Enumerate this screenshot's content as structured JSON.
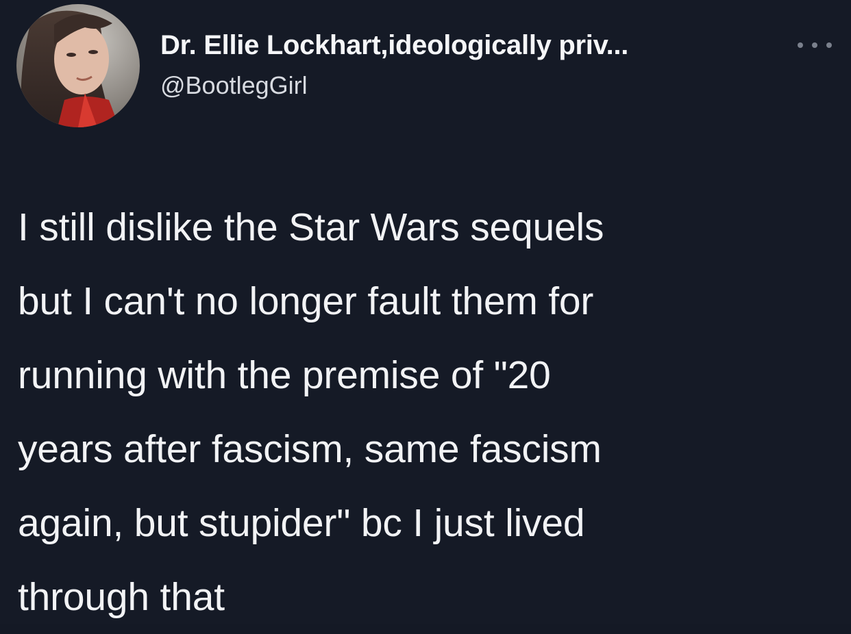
{
  "tweet": {
    "display_name": "Dr. Ellie Lockhart,ideologically priv...",
    "handle": "@BootlegGirl",
    "more_icon": "more-horizontal-icon",
    "avatar_icon": "profile-photo",
    "body_lines": [
      "I still dislike the Star Wars sequels",
      "but I can't no longer fault them for",
      "running with the premise of \"20",
      "years after fascism, same fascism",
      "again, but stupider\" bc I just lived",
      "through that"
    ]
  },
  "colors": {
    "background": "#151a26",
    "text": "#f2f3f5",
    "secondary_text": "#d7dae0"
  }
}
